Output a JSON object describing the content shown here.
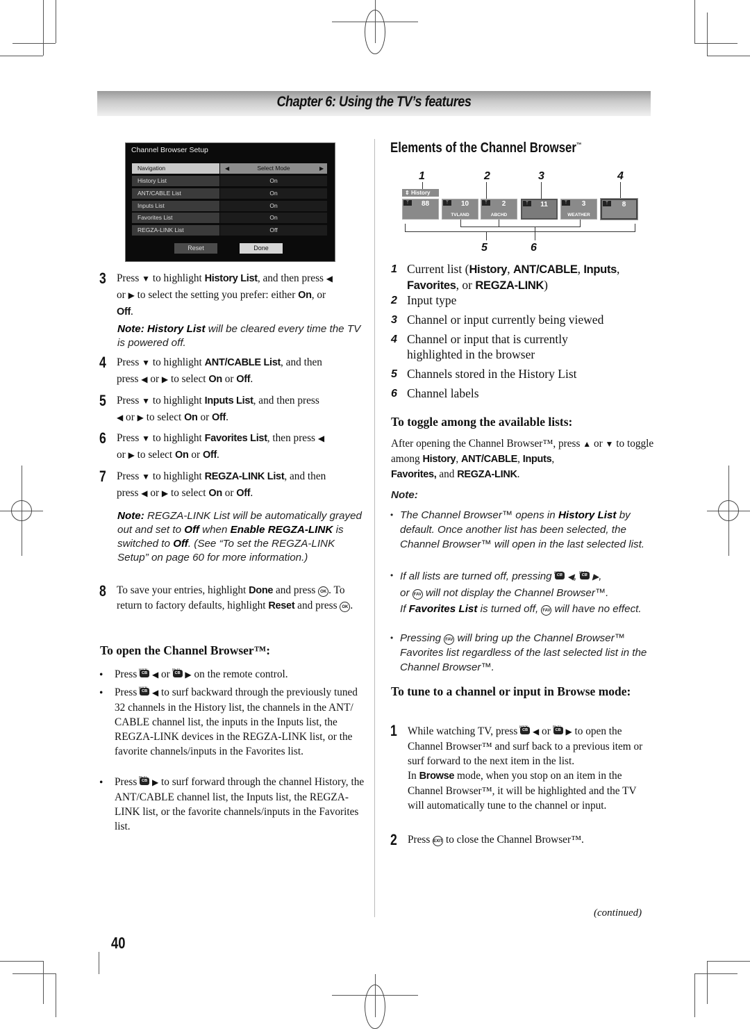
{
  "chapter_title": "Chapter 6: Using the TV’s features",
  "osd": {
    "title": "Channel Browser Setup",
    "rows": [
      {
        "label": "Navigation",
        "value": "Select Mode",
        "selected": true
      },
      {
        "label": "History List",
        "value": "On"
      },
      {
        "label": "ANT/CABLE List",
        "value": "On"
      },
      {
        "label": "Inputs List",
        "value": "On"
      },
      {
        "label": "Favorites List",
        "value": "On"
      },
      {
        "label": "REGZA-LINK List",
        "value": "Off"
      }
    ],
    "left_arrow": "◀",
    "right_arrow": "▶",
    "reset_label": "Reset",
    "done_label": "Done"
  },
  "left_steps": {
    "s3": {
      "num": "3",
      "a": "Press ",
      "b": " to highlight ",
      "bold1": "History List",
      "c": ", and then press ",
      "d": "or ",
      "e": " to select the setting you prefer: either ",
      "bold2": "On",
      "f": ", or",
      "bold3": "Off",
      "g": "."
    },
    "note1": {
      "label": "Note: History List",
      "text": " will be cleared every time the TV is powered off."
    },
    "s4": {
      "num": "4",
      "bold1": "ANT/CABLE List",
      "tail": ", and then"
    },
    "s5": {
      "num": "5",
      "bold1": "Inputs List",
      "tail": ", and then press"
    },
    "s6": {
      "num": "6",
      "bold1": "Favorites List",
      "tail": ", then press "
    },
    "s7": {
      "num": "7",
      "bold1": "REGZA-LINK List",
      "tail": ", and then"
    },
    "common": {
      "press": "Press ",
      "to_highlight": " to highlight ",
      "press_lc": "press ",
      "or": " or ",
      "or_lead": "or ",
      "to_select": " to select ",
      "on": "On",
      "off": "Off",
      "period": "."
    },
    "note2": {
      "label": "Note:",
      "t1": " REGZA-LINK List will be automatically grayed out and set to ",
      "off": "Off",
      "t2": " when ",
      "enable": "Enable REGZA-LINK",
      "t3": " is switched to ",
      "off2": "Off",
      "t4": ". (See “To set the REGZA-LINK Setup” on page 60 for more information.)"
    },
    "s8": {
      "num": "8",
      "t1": "To save your entries, highlight ",
      "done": "Done",
      "t2": " and press ",
      "t3": ". To return to factory defaults, highlight ",
      "reset": "Reset",
      "t4": " and press ",
      "t5": "."
    }
  },
  "open_browser": {
    "heading": "To open the Channel Browser™:",
    "b1": {
      "t1": "Press ",
      "t2": " or ",
      "t3": " on the remote control."
    },
    "b2": {
      "t1": "Press ",
      "t2": " to surf backward through the previously tuned 32 channels in the History list, the channels in the ANT/ CABLE channel list, the inputs in the Inputs list, the REGZA-LINK devices in the REGZA-LINK list, or the favorite channels/inputs in the Favorites list."
    },
    "b3": {
      "t1": "Press ",
      "t2": " to surf forward through the channel History, the ANT/CABLE channel list, the Inputs list, the REGZA-LINK list, or the favorite channels/inputs in the Favorites list."
    }
  },
  "icons": {
    "back": "BACK",
    "next": "NEXT",
    "cb": "CB",
    "ok": "OK",
    "fav": "FAV",
    "exit": "EXIT",
    "bullet": "•",
    "down": "▼",
    "up": "▲",
    "left": "◀",
    "right": "▶"
  },
  "elements": {
    "heading": "Elements of the Channel Browser",
    "tm": "™",
    "diagram": {
      "callouts_top": [
        "1",
        "2",
        "3",
        "4"
      ],
      "callouts_bottom": [
        "5",
        "6"
      ],
      "list_tag": "History",
      "tiles": [
        {
          "number": "88",
          "label": ""
        },
        {
          "number": "10",
          "label": "TVLAND"
        },
        {
          "number": "2",
          "label": "ABCHD"
        },
        {
          "number": "11",
          "label": "",
          "state": "current"
        },
        {
          "number": "3",
          "label": "WEATHER"
        },
        {
          "number": "8",
          "label": "",
          "state": "highlighted"
        }
      ]
    },
    "items": [
      {
        "num": "1",
        "t1": "Current list (",
        "b1": "History",
        "c1": ", ",
        "b2": "ANT/CABLE",
        "c2": ", ",
        "b3": "Inputs",
        "c3": ",",
        "b4": "Favorites",
        "c4": ", or ",
        "b5": "REGZA-LINK",
        "c5": ")"
      },
      {
        "num": "2",
        "text": "Input type"
      },
      {
        "num": "3",
        "text": "Channel or input currently being viewed"
      },
      {
        "num": "4",
        "text": "Channel or input that is currently highlighted in the browser"
      },
      {
        "num": "5",
        "text": "Channels stored in the History List"
      },
      {
        "num": "6",
        "text": "Channel labels"
      }
    ]
  },
  "toggle": {
    "heading": "To toggle among the available lists:",
    "t1": "After opening the Channel Browser™, press ",
    "t2": " or ",
    "t3": " to toggle among ",
    "b1": "History",
    "c1": ", ",
    "b2": "ANT/CABLE",
    "c2": ", ",
    "b3": "Inputs",
    "c3": ",",
    "b4": "Favorites,",
    "c4": " and ",
    "b5": "REGZA-LINK",
    "c5": ".",
    "note_label": "Note:",
    "n1": {
      "t1": "The Channel Browser™ opens in ",
      "b": "History List",
      "t2": " by default. Once another list has been selected, the Channel Browser™ will open in the last selected list."
    },
    "n2": {
      "t1": "If all lists are turned off, pressing ",
      "t2": ", ",
      "t3": ",",
      "t4": "or ",
      "t5": " will not display the Channel Browser™.",
      "t6": "If ",
      "b": "Favorites List",
      "t7": " is turned off, ",
      "t8": " will have no effect."
    },
    "n3": {
      "t1": "Pressing ",
      "t2": " will bring up the Channel Browser™ Favorites list regardless of the last selected list in the Channel Browser™."
    }
  },
  "tune": {
    "heading": "To tune to a channel or input in Browse mode:",
    "s1": {
      "num": "1",
      "t1": "While watching TV, press ",
      "t2": " or ",
      "t3": " to open the Channel Browser™ and surf back to a previous item or surf forward to the next item in the list.",
      "t4": "In ",
      "b": "Browse",
      "t5": " mode, when you stop on an item in the Channel Browser™, it will be highlighted and the TV will automatically tune to the channel or input."
    },
    "s2": {
      "num": "2",
      "t1": "Press ",
      "t2": " to close the Channel Browser™."
    }
  },
  "continued": "(continued)",
  "page_number": "40"
}
